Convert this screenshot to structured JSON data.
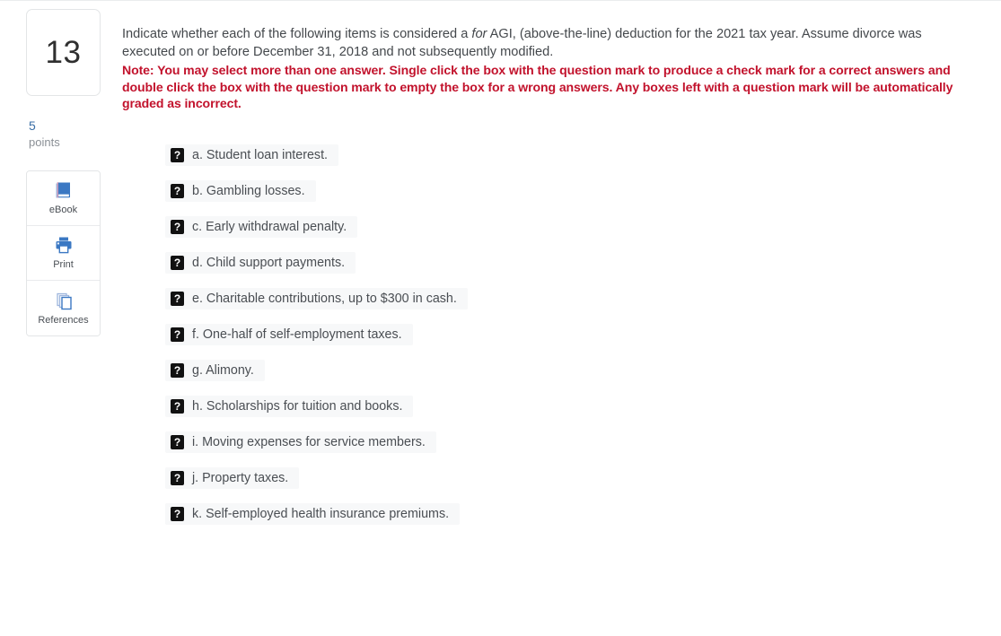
{
  "question": {
    "number": "13",
    "points_value": "5",
    "points_label": "points",
    "prompt_part1": "Indicate whether each of the following items is considered a ",
    "prompt_italic": "for",
    "prompt_part2": " AGI, (above-the-line) deduction for the 2021 tax year. Assume divorce was executed on or before December 31, 2018 and not subsequently modified.",
    "note": "Note: You may select more than one answer. Single click the box with the question mark to produce a check mark for a correct answers and double click the box with the question mark to empty the box for a wrong answers. Any boxes left with a question mark will be automatically graded as incorrect.",
    "note_color": "#c2122c"
  },
  "tools": [
    {
      "label": "eBook",
      "icon": "book-icon"
    },
    {
      "label": "Print",
      "icon": "printer-icon"
    },
    {
      "label": "References",
      "icon": "pages-stack-icon"
    }
  ],
  "answers": [
    {
      "marker": "?",
      "label": "a. Student loan interest."
    },
    {
      "marker": "?",
      "label": "b. Gambling losses."
    },
    {
      "marker": "?",
      "label": "c. Early withdrawal penalty."
    },
    {
      "marker": "?",
      "label": "d. Child support payments."
    },
    {
      "marker": "?",
      "label": "e. Charitable contributions, up to $300 in cash."
    },
    {
      "marker": "?",
      "label": "f. One-half of self-employment taxes."
    },
    {
      "marker": "?",
      "label": "g. Alimony."
    },
    {
      "marker": "?",
      "label": "h. Scholarships for tuition and books."
    },
    {
      "marker": "?",
      "label": "i. Moving expenses for service members."
    },
    {
      "marker": "?",
      "label": "j. Property taxes."
    },
    {
      "marker": "?",
      "label": "k. Self-employed health insurance premiums."
    }
  ],
  "theme": {
    "accent_blue": "#3b78c3",
    "points_blue": "#3a6ea5",
    "text_gray": "#4a4e53",
    "row_background": "#f7f8f9"
  }
}
